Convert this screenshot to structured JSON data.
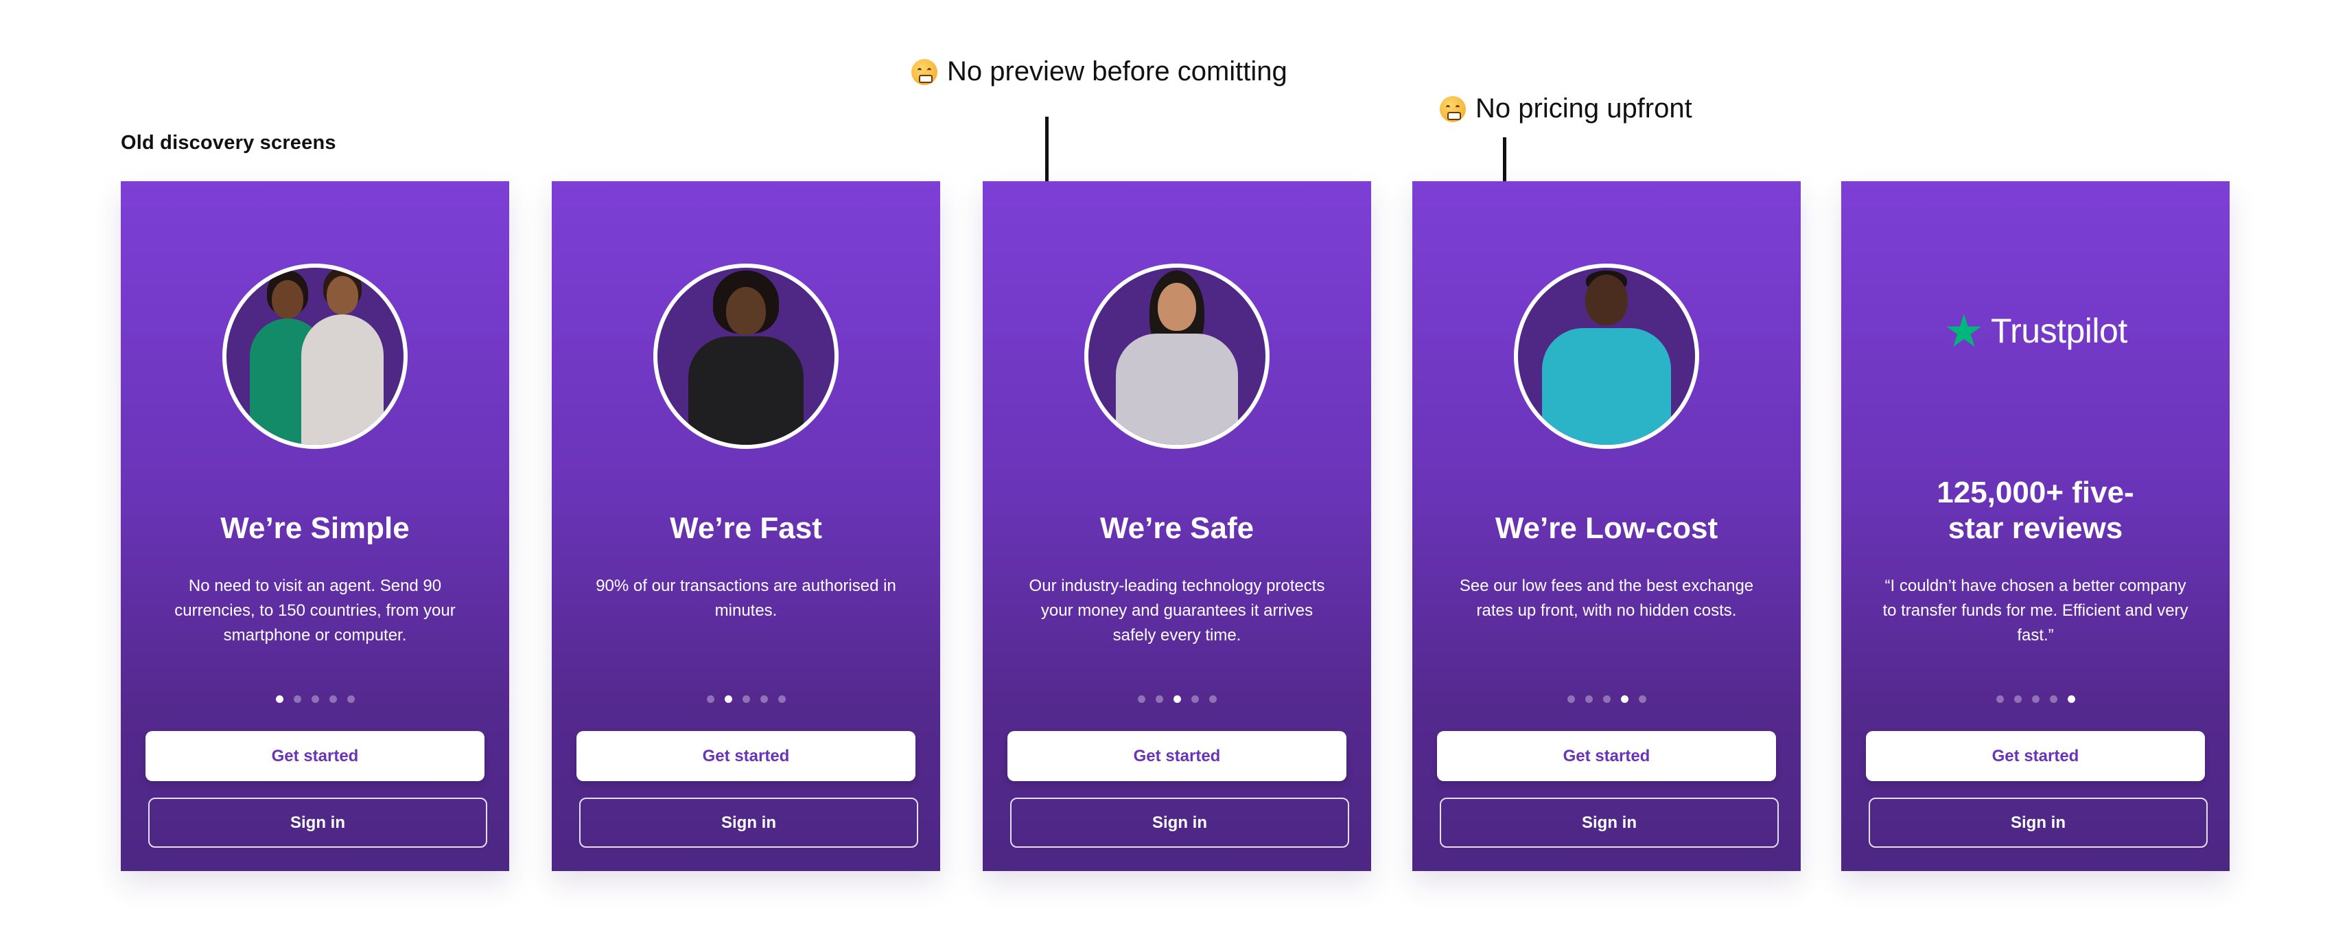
{
  "section_title": "Old discovery screens",
  "annotations": [
    {
      "text": "No preview before comitting",
      "icon": "anguished-face-icon"
    },
    {
      "text": "No pricing upfront",
      "icon": "anguished-face-icon"
    }
  ],
  "screens": [
    {
      "title": "We’re Simple",
      "description": "No need to visit an agent. Send 90 currencies, to 150 countries, from your smartphone or computer.",
      "active_dot": 1,
      "image": "two-women-with-phone-avatar"
    },
    {
      "title": "We’re Fast",
      "description": "90% of our transactions are authorised in minutes.",
      "active_dot": 2,
      "image": "woman-with-phone-avatar"
    },
    {
      "title": "We’re Safe",
      "description": "Our industry-leading technology protects your money and guarantees it arrives safely every time.",
      "active_dot": 3,
      "image": "woman-holding-phone-avatar"
    },
    {
      "title": "We’re Low-cost",
      "description": "See our low fees and the best exchange rates up front, with no hidden costs.",
      "active_dot": 4,
      "image": "man-with-phone-avatar"
    },
    {
      "title": "125,000+ five-star reviews",
      "description": "“I couldn’t have chosen a better company to transfer funds for me. Efficient and very fast.”",
      "active_dot": 5,
      "logo": "Trustpilot"
    }
  ],
  "buttons": {
    "primary": "Get started",
    "secondary": "Sign in"
  },
  "dot_count": 5,
  "colors": {
    "gradient_top": "#7d3fd6",
    "gradient_bottom": "#4d2784",
    "trustpilot_star": "#00b67a",
    "button_text": "#6a34b8"
  }
}
